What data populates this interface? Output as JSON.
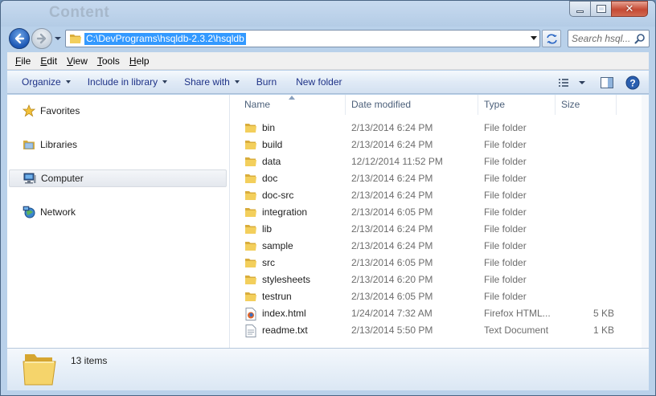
{
  "window": {
    "title": "Content"
  },
  "address": {
    "path": "C:\\DevPrograms\\hsqldb-2.3.2\\hsqldb"
  },
  "search": {
    "placeholder": "Search hsql..."
  },
  "menu": {
    "items": [
      {
        "label": "File",
        "accel": "F",
        "rest": "ile"
      },
      {
        "label": "Edit",
        "accel": "E",
        "rest": "dit"
      },
      {
        "label": "View",
        "accel": "V",
        "rest": "iew"
      },
      {
        "label": "Tools",
        "accel": "T",
        "rest": "ools"
      },
      {
        "label": "Help",
        "accel": "H",
        "rest": "elp"
      }
    ]
  },
  "toolbar": {
    "organize": "Organize",
    "include_in_library": "Include in library",
    "share_with": "Share with",
    "burn": "Burn",
    "new_folder": "New folder"
  },
  "navpane": {
    "items": [
      {
        "label": "Favorites",
        "icon": "star-icon"
      },
      {
        "label": "Libraries",
        "icon": "libraries-icon"
      },
      {
        "label": "Computer",
        "icon": "computer-icon",
        "selected": true
      },
      {
        "label": "Network",
        "icon": "network-icon"
      }
    ]
  },
  "columns": {
    "name": "Name",
    "date": "Date modified",
    "type": "Type",
    "size": "Size"
  },
  "files": [
    {
      "name": "bin",
      "date": "2/13/2014 6:24 PM",
      "type": "File folder",
      "size": "",
      "icon": "folder-icon"
    },
    {
      "name": "build",
      "date": "2/13/2014 6:24 PM",
      "type": "File folder",
      "size": "",
      "icon": "folder-icon"
    },
    {
      "name": "data",
      "date": "12/12/2014 11:52 PM",
      "type": "File folder",
      "size": "",
      "icon": "folder-icon"
    },
    {
      "name": "doc",
      "date": "2/13/2014 6:24 PM",
      "type": "File folder",
      "size": "",
      "icon": "folder-icon"
    },
    {
      "name": "doc-src",
      "date": "2/13/2014 6:24 PM",
      "type": "File folder",
      "size": "",
      "icon": "folder-icon"
    },
    {
      "name": "integration",
      "date": "2/13/2014 6:05 PM",
      "type": "File folder",
      "size": "",
      "icon": "folder-icon"
    },
    {
      "name": "lib",
      "date": "2/13/2014 6:24 PM",
      "type": "File folder",
      "size": "",
      "icon": "folder-icon"
    },
    {
      "name": "sample",
      "date": "2/13/2014 6:24 PM",
      "type": "File folder",
      "size": "",
      "icon": "folder-icon"
    },
    {
      "name": "src",
      "date": "2/13/2014 6:05 PM",
      "type": "File folder",
      "size": "",
      "icon": "folder-icon"
    },
    {
      "name": "stylesheets",
      "date": "2/13/2014 6:20 PM",
      "type": "File folder",
      "size": "",
      "icon": "folder-icon"
    },
    {
      "name": "testrun",
      "date": "2/13/2014 6:05 PM",
      "type": "File folder",
      "size": "",
      "icon": "folder-icon"
    },
    {
      "name": "index.html",
      "date": "1/24/2014 7:32 AM",
      "type": "Firefox HTML...",
      "size": "5 KB",
      "icon": "firefox-html-icon"
    },
    {
      "name": "readme.txt",
      "date": "2/13/2014 5:50 PM",
      "type": "Text Document",
      "size": "1 KB",
      "icon": "text-document-icon"
    }
  ],
  "status": {
    "item_count": "13 items"
  },
  "colors": {
    "accent": "#3399ff",
    "command_text": "#1e3287",
    "folder": "#f3cf5c"
  }
}
